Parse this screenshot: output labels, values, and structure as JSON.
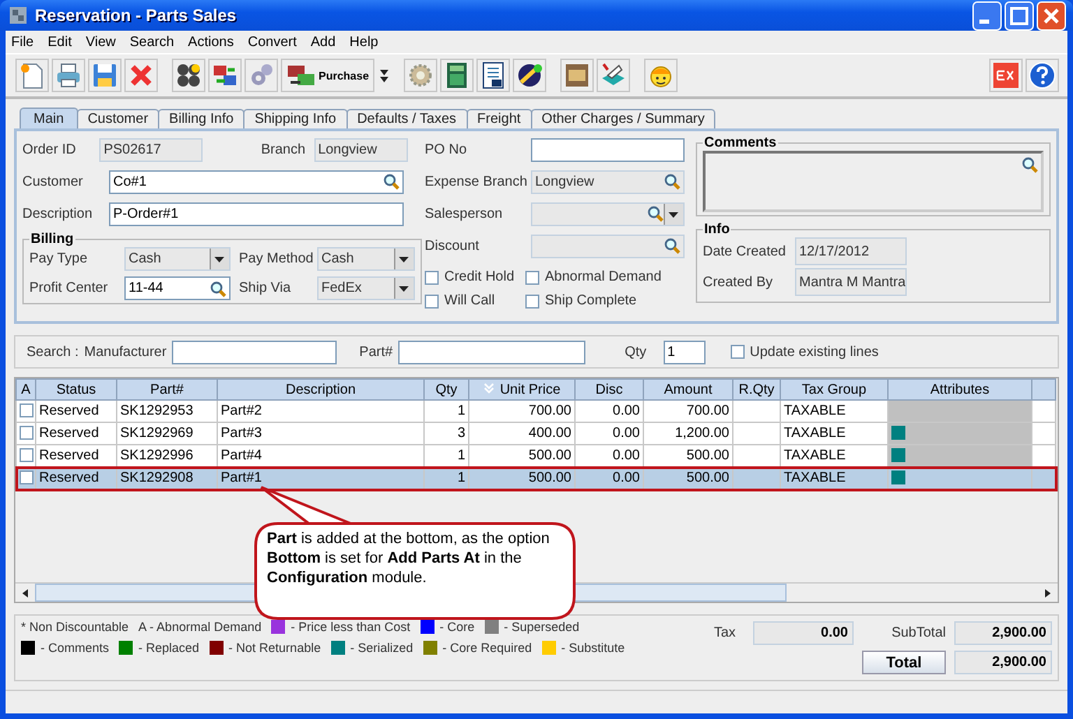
{
  "window": {
    "title": "Reservation - Parts Sales"
  },
  "menu": [
    "File",
    "Edit",
    "View",
    "Search",
    "Actions",
    "Convert",
    "Add",
    "Help"
  ],
  "toolbar": {
    "purchase_label": "Purchase"
  },
  "tabs": [
    {
      "label": "Main",
      "selected": true
    },
    {
      "label": "Customer",
      "selected": false
    },
    {
      "label": "Billing Info",
      "selected": false
    },
    {
      "label": "Shipping Info",
      "selected": false
    },
    {
      "label": "Defaults / Taxes",
      "selected": false
    },
    {
      "label": "Freight",
      "selected": false
    },
    {
      "label": "Other Charges / Summary",
      "selected": false
    }
  ],
  "header": {
    "order_id": {
      "label": "Order ID",
      "value": "PS02617",
      "editable": false,
      "lookup": false,
      "dropdown": false
    },
    "branch": {
      "label": "Branch",
      "value": "Longview",
      "editable": false,
      "lookup": false,
      "dropdown": false
    },
    "customer": {
      "label": "Customer",
      "value": "Co#1",
      "editable": true,
      "lookup": true,
      "dropdown": false
    },
    "description": {
      "label": "Description",
      "value": "P-Order#1",
      "editable": true,
      "lookup": false,
      "dropdown": false
    },
    "po_no": {
      "label": "PO No",
      "editable": true,
      "lookup": false,
      "dropdown": false
    },
    "expense_branch": {
      "label": "Expense Branch",
      "value": "Longview",
      "editable": false,
      "lookup": true,
      "dropdown": false
    },
    "salesperson": {
      "label": "Salesperson",
      "editable": false,
      "lookup": true,
      "dropdown": true
    },
    "discount": {
      "label": "Discount",
      "editable": false,
      "lookup": true,
      "dropdown": false
    }
  },
  "billing": {
    "title": "Billing",
    "fields": [
      {
        "label": "Pay Type",
        "value": "Cash",
        "editable": false,
        "lookup": false,
        "dropdown": true
      },
      {
        "label": "Pay Method",
        "value": "Cash",
        "editable": false,
        "lookup": false,
        "dropdown": true
      },
      {
        "label": "Profit Center",
        "value": "11-44",
        "editable": true,
        "lookup": true,
        "dropdown": false
      },
      {
        "label": "Ship Via",
        "value": "FedEx",
        "editable": false,
        "lookup": false,
        "dropdown": true
      }
    ]
  },
  "options": [
    {
      "label": "Credit Hold",
      "checked": false
    },
    {
      "label": "Abnormal Demand",
      "checked": false
    },
    {
      "label": "Will Call",
      "checked": false
    },
    {
      "label": "Ship Complete",
      "checked": false
    }
  ],
  "comments": {
    "title": "Comments"
  },
  "info": {
    "title": "Info",
    "fields": [
      {
        "label": "Date Created",
        "value": "12/17/2012"
      },
      {
        "label": "Created By",
        "value": "Mantra M Mantra"
      }
    ]
  },
  "search": {
    "label": "Search :",
    "manufacturer_label": "Manufacturer",
    "part_label": "Part#",
    "qty_label": "Qty",
    "qty_value": "1",
    "update_label": "Update existing lines",
    "update_checked": false
  },
  "table": {
    "columns": [
      {
        "label": "A",
        "sorted": false
      },
      {
        "label": "Status",
        "sorted": false
      },
      {
        "label": "Part#",
        "sorted": false
      },
      {
        "label": "Description",
        "sorted": false
      },
      {
        "label": "Qty",
        "sorted": false
      },
      {
        "label": "Unit Price",
        "sorted": true
      },
      {
        "label": "Disc",
        "sorted": false
      },
      {
        "label": "Amount",
        "sorted": false
      },
      {
        "label": "R.Qty",
        "sorted": false
      },
      {
        "label": "Tax Group",
        "sorted": false
      },
      {
        "label": "Attributes",
        "sorted": false
      },
      {
        "sorted": false
      }
    ],
    "rows": [
      {
        "checked": false,
        "status": "Reserved",
        "part": "SK1292953",
        "description": "Part#2",
        "qty": "1",
        "unit_price": "700.00",
        "disc": "0.00",
        "amount": "700.00",
        "tax_group": "TAXABLE",
        "selected": false,
        "outlined": false
      },
      {
        "checked": false,
        "status": "Reserved",
        "part": "SK1292969",
        "description": "Part#3",
        "qty": "3",
        "unit_price": "400.00",
        "disc": "0.00",
        "amount": "1,200.00",
        "tax_group": "TAXABLE",
        "color": "#008080",
        "selected": false,
        "outlined": false
      },
      {
        "checked": false,
        "status": "Reserved",
        "part": "SK1292996",
        "description": "Part#4",
        "qty": "1",
        "unit_price": "500.00",
        "disc": "0.00",
        "amount": "500.00",
        "tax_group": "TAXABLE",
        "color": "#008080",
        "selected": false,
        "outlined": false
      },
      {
        "checked": false,
        "status": "Reserved",
        "part": "SK1292908",
        "description": "Part#1",
        "qty": "1",
        "unit_price": "500.00",
        "disc": "0.00",
        "amount": "500.00",
        "tax_group": "TAXABLE",
        "color": "#008080",
        "selected": true,
        "outlined": true
      }
    ]
  },
  "callout": {
    "text": "**Part** is added at the bottom, as the option **Bottom** is set for **Add Parts At** in the **Configuration** module."
  },
  "legend": [
    [
      {
        "kind": "text",
        "label": "* Non Discountable"
      },
      {
        "kind": "text",
        "label": "A - Abnormal Demand"
      },
      {
        "kind": "swatch",
        "color": "#9933dd",
        "label": "- Price less than Cost"
      },
      {
        "kind": "swatch",
        "color": "#0000ff",
        "label": "- Core"
      },
      {
        "kind": "swatch",
        "color": "#808080",
        "label": "- Superseded"
      }
    ],
    [
      {
        "kind": "swatch",
        "color": "#000000",
        "label": "- Comments"
      },
      {
        "kind": "swatch",
        "color": "#008000",
        "label": "- Replaced"
      },
      {
        "kind": "swatch",
        "color": "#800000",
        "label": "- Not Returnable"
      },
      {
        "kind": "swatch",
        "color": "#008080",
        "label": "- Serialized"
      },
      {
        "kind": "swatch",
        "color": "#808000",
        "label": "- Core Required"
      },
      {
        "kind": "swatch",
        "color": "#ffcc00",
        "label": "- Substitute"
      }
    ]
  ],
  "totals": {
    "tax_label": "Tax",
    "tax_value": "0.00",
    "subtotal_label": "SubTotal",
    "subtotal_value": "2,900.00",
    "total_label": "Total",
    "total_value": "2,900.00"
  }
}
